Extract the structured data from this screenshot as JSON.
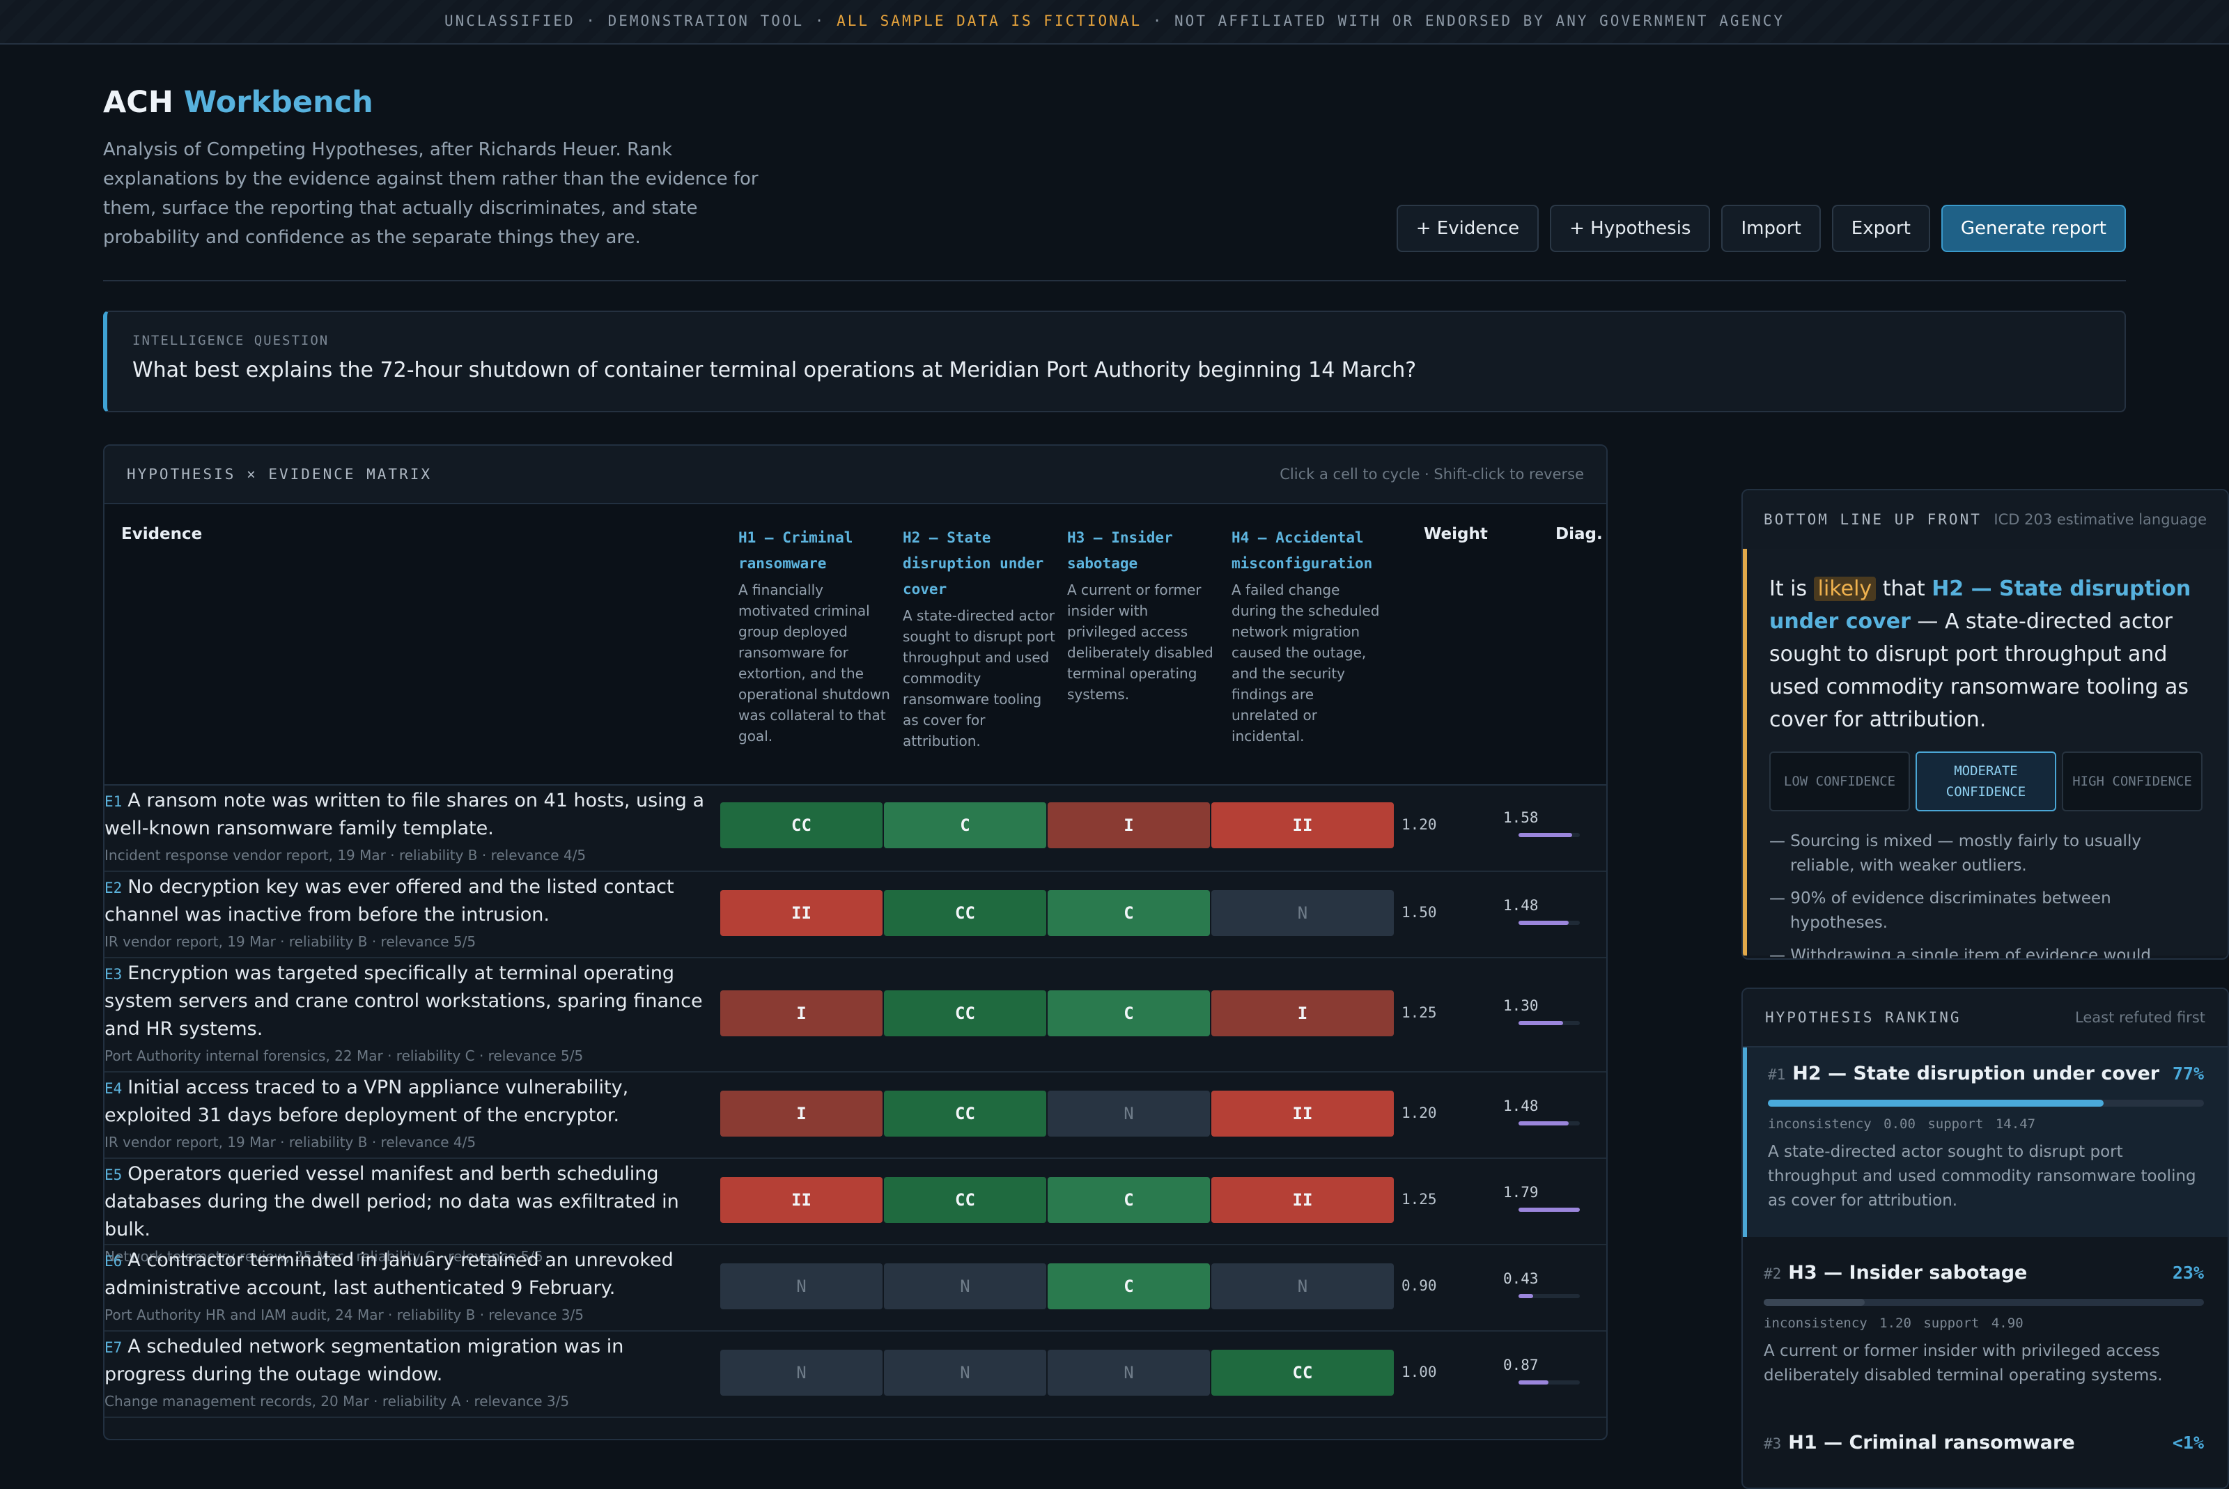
{
  "banner": {
    "prefix": "UNCLASSIFIED · DEMONSTRATION TOOL · ",
    "highlight": "ALL SAMPLE DATA IS FICTIONAL",
    "suffix": " · NOT AFFILIATED WITH OR ENDORSED BY ANY GOVERNMENT AGENCY"
  },
  "header": {
    "title_main": "ACH",
    "title_accent": "Workbench",
    "subtitle": "Analysis of Competing Hypotheses, after Richards Heuer. Rank explanations by the evidence against them rather than the evidence for them, surface the reporting that actually discriminates, and state probability and confidence as the separate things they are."
  },
  "toolbar": {
    "add_evidence": "+ Evidence",
    "add_hypothesis": "+ Hypothesis",
    "import": "Import",
    "export": "Export",
    "generate": "Generate report"
  },
  "question": {
    "label": "INTELLIGENCE QUESTION",
    "text": "What best explains the 72-hour shutdown of container terminal operations at Meridian Port Authority beginning 14 March?"
  },
  "matrix": {
    "title": "HYPOTHESIS × EVIDENCE MATRIX",
    "hint": "Click a cell to cycle · Shift-click to reverse",
    "col_evidence": "Evidence",
    "col_weight": "Weight",
    "col_diag": "Diag.",
    "hypotheses": [
      {
        "name": "H1 — Criminal ransomware",
        "desc": "A financially motivated criminal group deployed ransomware for extortion, and the operational shutdown was collateral to that goal."
      },
      {
        "name": "H2 — State disruption under cover",
        "desc": "A state-directed actor sought to disrupt port throughput and used commodity ransomware tooling as cover for attribution."
      },
      {
        "name": "H3 — Insider sabotage",
        "desc": "A current or former insider with privileged access deliberately disabled terminal operating systems."
      },
      {
        "name": "H4 — Accidental misconfiguration",
        "desc": "A failed change during the scheduled network migration caused the outage, and the security findings are unrelated or incidental."
      }
    ],
    "rows": [
      {
        "id": "E1",
        "text": "A ransom note was written to file shares on 41 hosts, using a well-known ransomware family template.",
        "meta": "Incident response vendor report, 19 Mar · reliability B · relevance 4/5",
        "cells": [
          "CC",
          "C",
          "I",
          "II"
        ],
        "weight": "1.20",
        "diag": "1.58",
        "diag_value": 1.58
      },
      {
        "id": "E2",
        "text": "No decryption key was ever offered and the listed contact channel was inactive from before the intrusion.",
        "meta": "IR vendor report, 19 Mar · reliability B · relevance 5/5",
        "cells": [
          "II",
          "CC",
          "C",
          "N"
        ],
        "weight": "1.50",
        "diag": "1.48",
        "diag_value": 1.48
      },
      {
        "id": "E3",
        "text": "Encryption was targeted specifically at terminal operating system servers and crane control workstations, sparing finance and HR systems.",
        "meta": "Port Authority internal forensics, 22 Mar · reliability C · relevance 5/5",
        "cells": [
          "I",
          "CC",
          "C",
          "I"
        ],
        "weight": "1.25",
        "diag": "1.30",
        "diag_value": 1.3
      },
      {
        "id": "E4",
        "text": "Initial access traced to a VPN appliance vulnerability, exploited 31 days before deployment of the encryptor.",
        "meta": "IR vendor report, 19 Mar · reliability B · relevance 4/5",
        "cells": [
          "I",
          "CC",
          "N",
          "II"
        ],
        "weight": "1.20",
        "diag": "1.48",
        "diag_value": 1.48
      },
      {
        "id": "E5",
        "text": "Operators queried vessel manifest and berth scheduling databases during the dwell period; no data was exfiltrated in bulk.",
        "meta": "Network telemetry review, 25 Mar · reliability C · relevance 5/5",
        "cells": [
          "II",
          "CC",
          "C",
          "II"
        ],
        "weight": "1.25",
        "diag": "1.79",
        "diag_value": 1.79
      },
      {
        "id": "E6",
        "text": "A contractor terminated in January retained an unrevoked administrative account, last authenticated 9 February.",
        "meta": "Port Authority HR and IAM audit, 24 Mar · reliability B · relevance 3/5",
        "cells": [
          "N",
          "N",
          "C",
          "N"
        ],
        "weight": "0.90",
        "diag": "0.43",
        "diag_value": 0.43
      },
      {
        "id": "E7",
        "text": "A scheduled network segmentation migration was in progress during the outage window.",
        "meta": "Change management records, 20 Mar · reliability A · relevance 3/5",
        "cells": [
          "N",
          "N",
          "N",
          "CC"
        ],
        "weight": "1.00",
        "diag": "0.87",
        "diag_value": 0.87
      }
    ]
  },
  "bluf": {
    "title": "BOTTOM LINE UP FRONT",
    "hint": "ICD 203 estimative language",
    "lead": "It is ",
    "likelihood": "likely",
    "that": " that ",
    "hypothesis": "H2 — State disruption under cover",
    "rest": " — A state-directed actor sought to disrupt port throughput and used commodity ransomware tooling as cover for attribution.",
    "confidence_levels": [
      "LOW CONFIDENCE",
      "MODERATE CONFIDENCE",
      "HIGH CONFIDENCE"
    ],
    "confidence_selected": "MODERATE CONFIDENCE",
    "notes": [
      "— Sourcing is mixed — mostly fairly to usually reliable, with weaker outliers.",
      "— 90% of evidence discriminates between hypotheses.",
      "— Withdrawing a single item of evidence would collapse the separation between the top two hypotheses."
    ]
  },
  "ranking": {
    "title": "HYPOTHESIS RANKING",
    "hint": "Least refuted first",
    "items": [
      {
        "rank": "#1",
        "name": "H2 — State disruption under cover",
        "pct": "77%",
        "share": 0.77,
        "inconsistency": "inconsistency 0.00",
        "support": "support 14.47",
        "desc": "A state-directed actor sought to disrupt port throughput and used commodity ransomware tooling as cover for attribution."
      },
      {
        "rank": "#2",
        "name": "H3 — Insider sabotage",
        "pct": "23%",
        "share": 0.23,
        "inconsistency": "inconsistency 1.20",
        "support": "support 4.90",
        "desc": "A current or former insider with privileged access deliberately disabled terminal operating systems."
      },
      {
        "rank": "#3",
        "name": "H1 — Criminal ransomware",
        "pct": "<1%",
        "share": 0.005
      }
    ]
  },
  "colors": {
    "accent": "#57b2de",
    "warning": "#e2a94a",
    "consistent": "#2a7a4e",
    "inconsistent": "#b54036",
    "diagnostic": "#9b86dc"
  }
}
